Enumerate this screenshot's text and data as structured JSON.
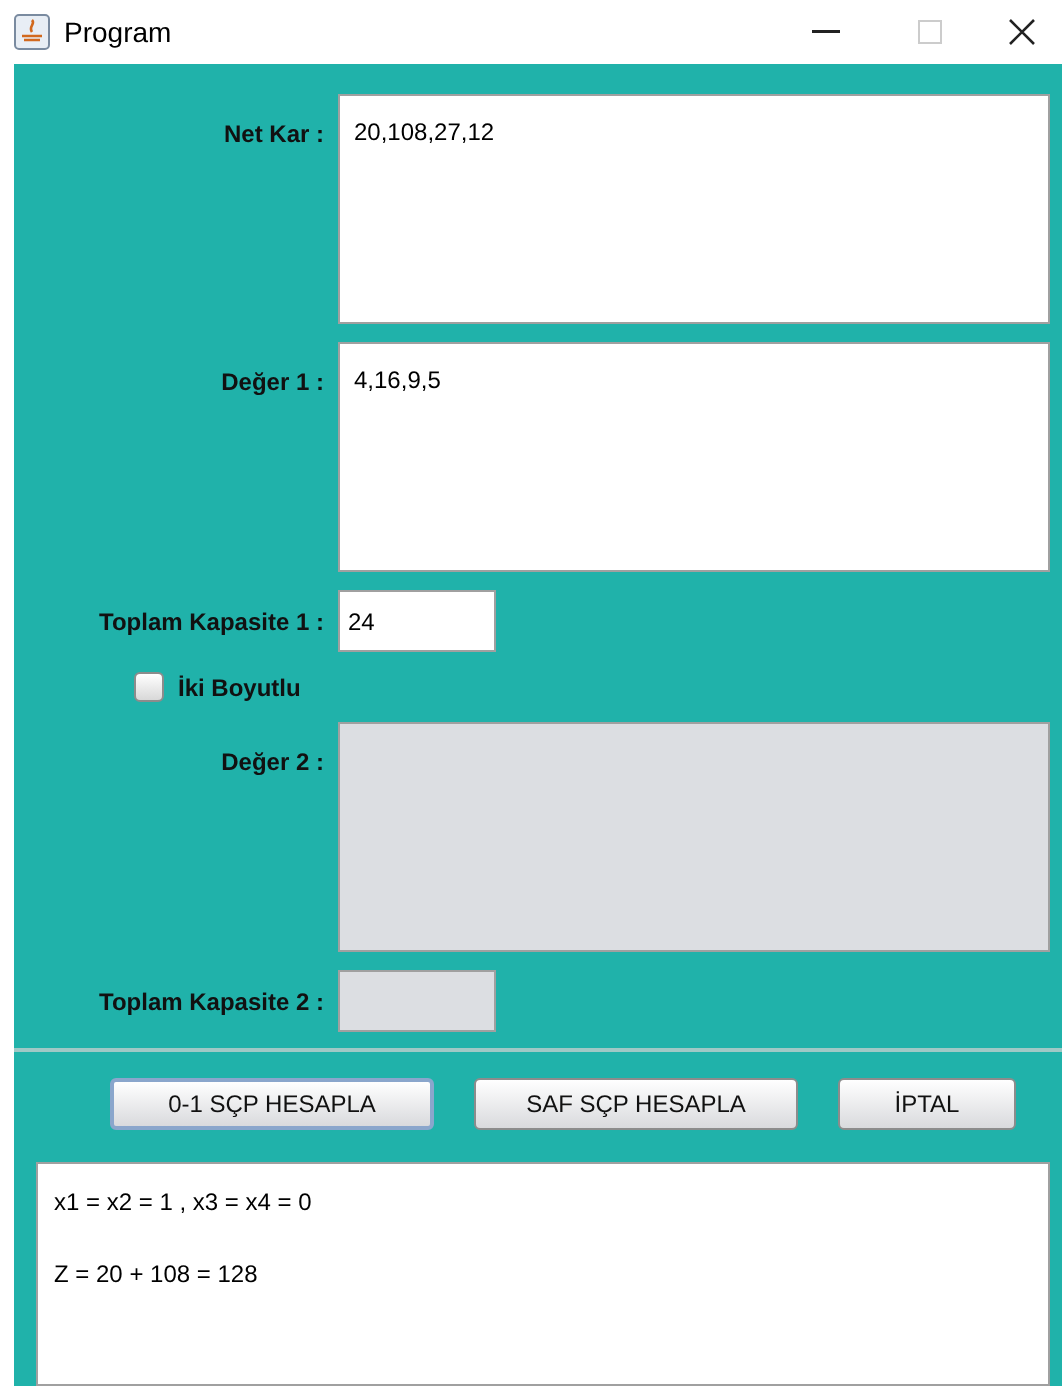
{
  "window": {
    "title": "Program"
  },
  "fields": [
    {
      "kind": "textarea",
      "label": "Net Kar :",
      "value": "20,108,27,12",
      "disabled": false
    },
    {
      "kind": "textarea",
      "label": "Değer 1 :",
      "value": "4,16,9,5",
      "disabled": false
    },
    {
      "kind": "input",
      "label": "Toplam Kapasite 1 :",
      "value": "24",
      "disabled": false
    },
    {
      "kind": "checkbox",
      "label": "İki Boyutlu",
      "checked": false
    },
    {
      "kind": "textarea",
      "label": "Değer 2 :",
      "disabled": true
    },
    {
      "kind": "input",
      "label": "Toplam Kapasite 2 :",
      "disabled": true
    }
  ],
  "buttons": [
    {
      "label": "0-1 SÇP HESAPLA",
      "focused": true
    },
    {
      "label": "SAF SÇP HESAPLA",
      "focused": false
    },
    {
      "label": "İPTAL",
      "focused": false
    }
  ],
  "output": [
    "x1 = x2 = 1 , x3 = x4 = 0",
    "Z = 20 + 108 = 128"
  ]
}
